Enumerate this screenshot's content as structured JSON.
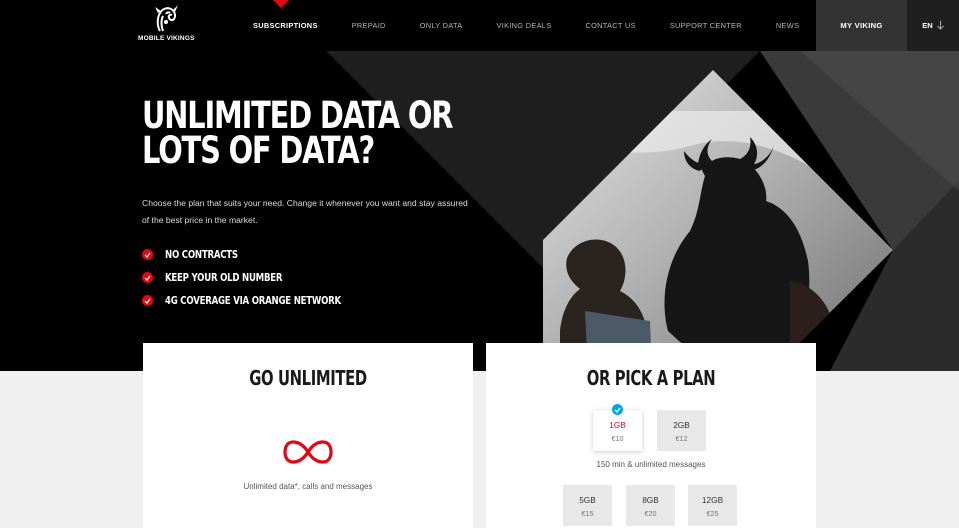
{
  "header": {
    "logo_text": "MOBILE VIKINGS",
    "nav": [
      {
        "label": "SUBSCRIPTIONS",
        "active": true
      },
      {
        "label": "PREPAID"
      },
      {
        "label": "ONLY DATA"
      },
      {
        "label": "VIKING DEALS"
      },
      {
        "label": "CONTACT US"
      },
      {
        "label": "SUPPORT CENTER"
      },
      {
        "label": "NEWS"
      }
    ],
    "my_viking": "MY VIKING",
    "language": "EN"
  },
  "hero": {
    "title_line1": "UNLIMITED DATA OR",
    "title_line2": "LOTS OF DATA?",
    "description": "Choose the plan that suits your need. Change it whenever you want and stay assured of the best price in the market.",
    "bullets": [
      "NO CONTRACTS",
      "KEEP YOUR OLD NUMBER",
      "4G COVERAGE VIA ORANGE NETWORK"
    ]
  },
  "unlimited_card": {
    "title": "GO UNLIMITED",
    "description": "Unlimited data*, calls and messages"
  },
  "plan_card": {
    "title": "OR PICK A PLAN",
    "plans_row1": [
      {
        "size": "1GB",
        "price": "€10",
        "selected": true
      },
      {
        "size": "2GB",
        "price": "€12"
      }
    ],
    "note": "150 min & unlimited messages",
    "plans_row2": [
      {
        "size": "5GB",
        "price": "€15"
      },
      {
        "size": "8GB",
        "price": "€20"
      },
      {
        "size": "12GB",
        "price": "€25"
      }
    ]
  },
  "colors": {
    "accent": "#e30613",
    "selected_check": "#00a7e1",
    "background": "#000000"
  },
  "icons": [
    "viking-helmet-logo-icon",
    "check-icon",
    "infinity-icon",
    "arrow-down-icon"
  ]
}
